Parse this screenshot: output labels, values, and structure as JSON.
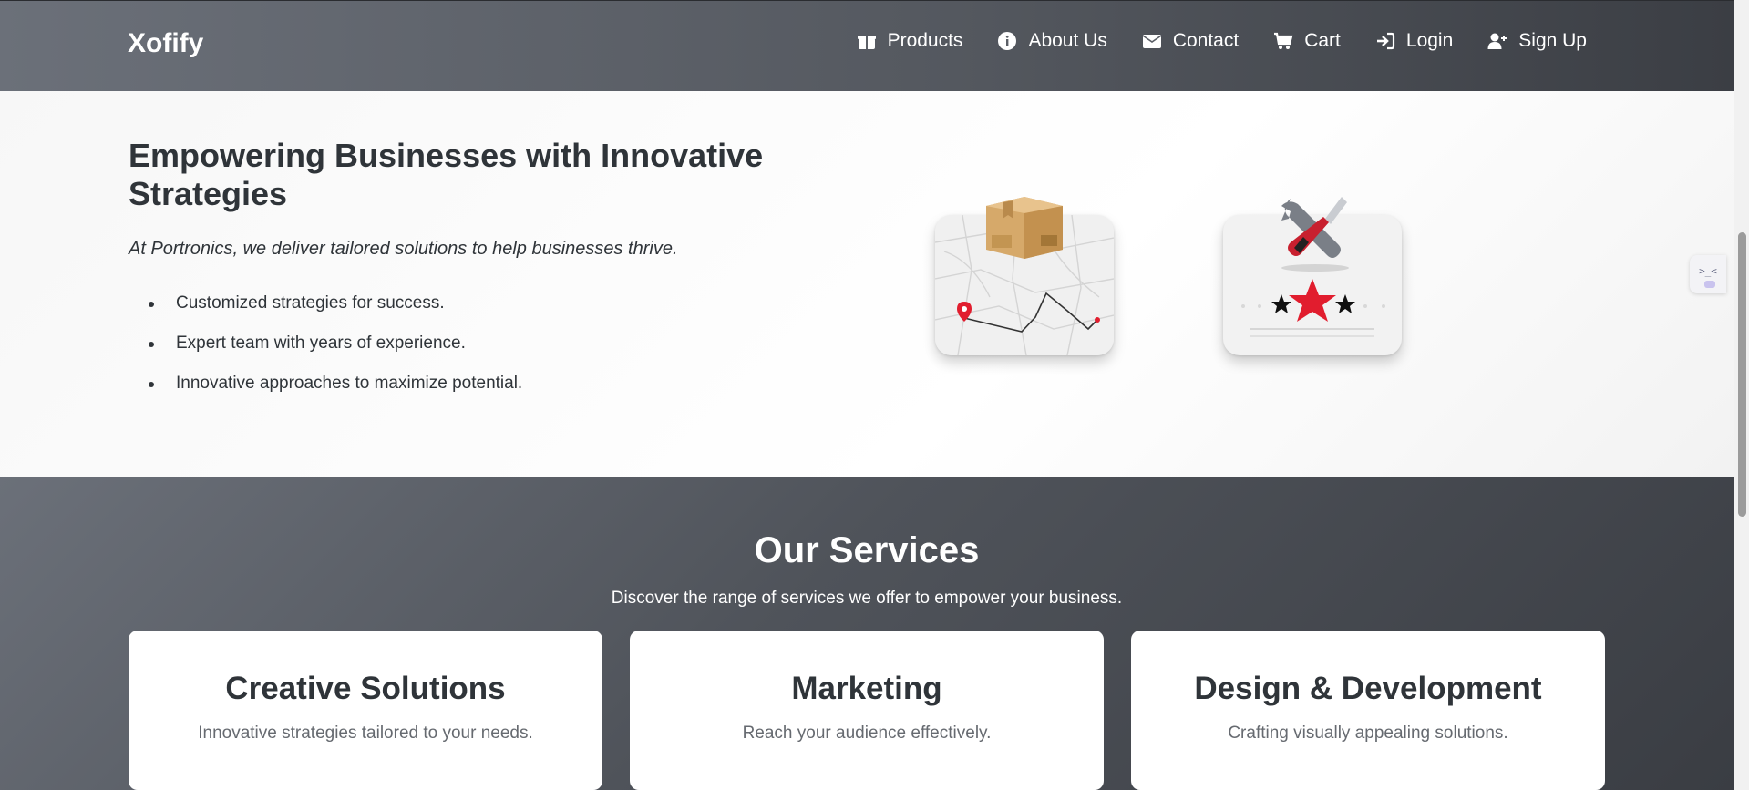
{
  "nav": {
    "brand": "Xofify",
    "items": [
      {
        "label": "Products",
        "icon": "gift-icon"
      },
      {
        "label": "About Us",
        "icon": "info-icon"
      },
      {
        "label": "Contact",
        "icon": "envelope-icon"
      },
      {
        "label": "Cart",
        "icon": "cart-icon"
      },
      {
        "label": "Login",
        "icon": "sign-in-icon"
      },
      {
        "label": "Sign Up",
        "icon": "user-plus-icon"
      }
    ]
  },
  "hero": {
    "title": "Empowering Businesses with Innovative Strategies",
    "subtitle": "At Portronics, we deliver tailored solutions to help businesses thrive.",
    "bullets": [
      "Customized strategies for success.",
      "Expert team with years of experience.",
      "Innovative approaches to maximize potential."
    ],
    "images": [
      "delivery-map-illustration",
      "tools-rating-illustration"
    ]
  },
  "side_tab": {
    "icon": "extension-tab-icon",
    "text": ">_<"
  },
  "services": {
    "title": "Our Services",
    "subtitle": "Discover the range of services we offer to empower your business.",
    "cards": [
      {
        "title": "Creative Solutions",
        "text": "Innovative strategies tailored to your needs."
      },
      {
        "title": "Marketing",
        "text": "Reach your audience effectively."
      },
      {
        "title": "Design & Development",
        "text": "Crafting visually appealing solutions."
      }
    ]
  },
  "colors": {
    "nav_bg": "#54585f",
    "text_dark": "#2f3439",
    "accent_red": "#e11d2e"
  }
}
